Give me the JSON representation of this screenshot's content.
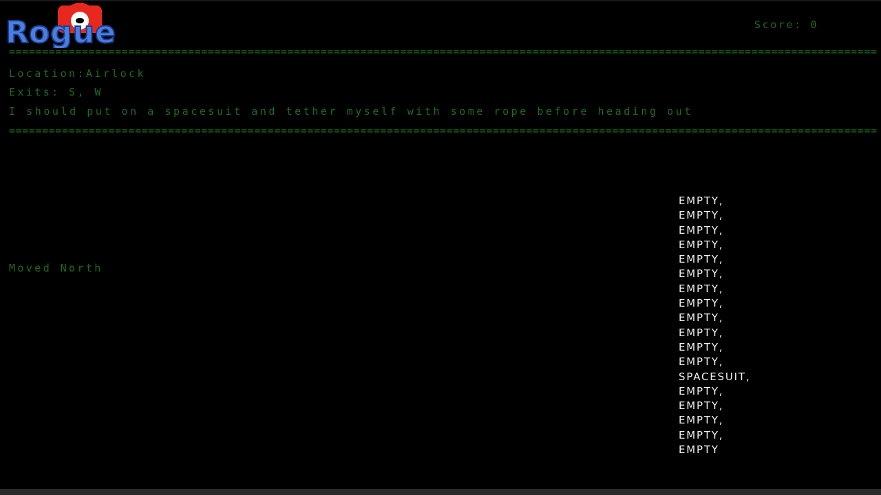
{
  "header": {
    "logo_text": "Rogue",
    "score_label": "Score:",
    "score_value": "0"
  },
  "room": {
    "location_label": "Location:",
    "location": "Airlock",
    "exits_label": "Exits:",
    "exits": "S, W",
    "message": "I should put on a spacesuit and tether myself with some rope before heading out"
  },
  "status": {
    "last_action": "Moved North"
  },
  "inventory": {
    "items": [
      "EMPTY,",
      "EMPTY,",
      "EMPTY,",
      "EMPTY,",
      "EMPTY,",
      "EMPTY,",
      "EMPTY,",
      "EMPTY,",
      "EMPTY,",
      "EMPTY,",
      "EMPTY,",
      "EMPTY,",
      "SPACESUIT,",
      "EMPTY,",
      "EMPTY,",
      "EMPTY,",
      "EMPTY,",
      "EMPTY"
    ]
  },
  "colors": {
    "terminal_green": "#1f6b1f",
    "inventory_text": "#f2f2f2",
    "background": "#000000",
    "logo_blue": "#4a7fe0",
    "logo_red": "#e8281e"
  },
  "divider_char": "="
}
